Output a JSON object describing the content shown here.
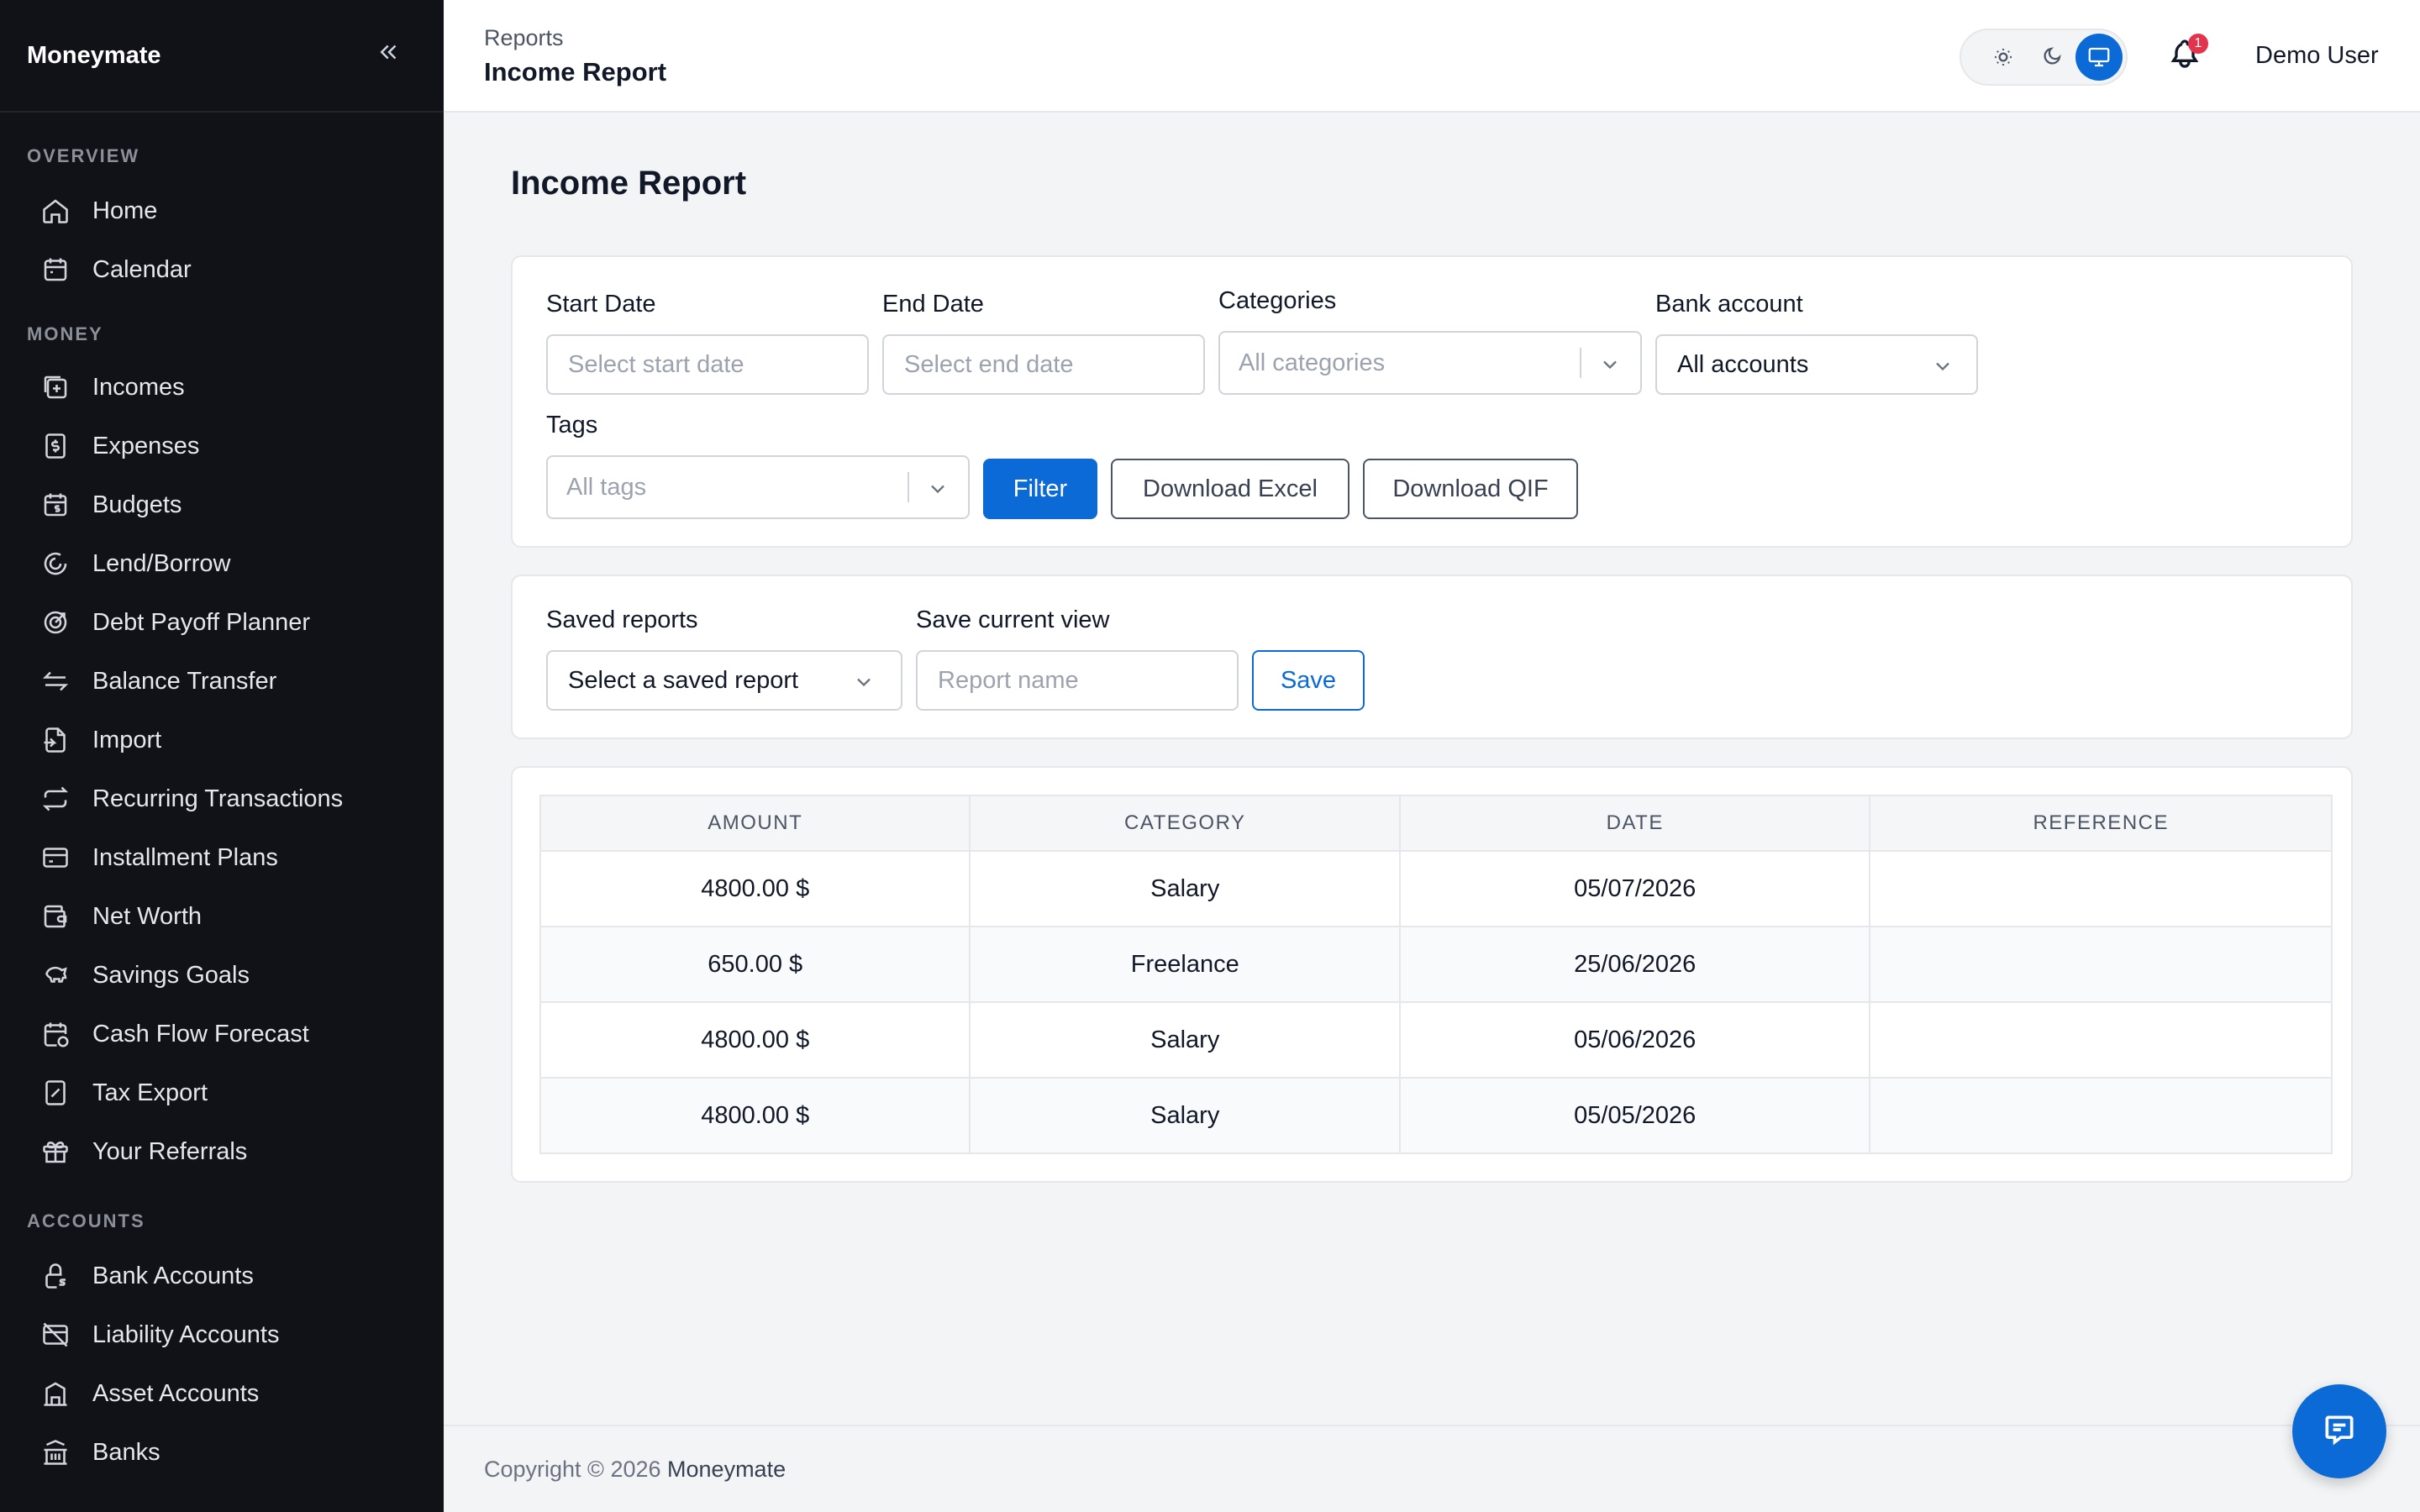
{
  "sidebar": {
    "brand": "Moneymate",
    "collapse_icon": "double-chevron-left-icon",
    "sections": [
      {
        "title": "OVERVIEW",
        "items": [
          {
            "label": "Home",
            "icon": "home-icon"
          },
          {
            "label": "Calendar",
            "icon": "calendar-icon"
          }
        ]
      },
      {
        "title": "MONEY",
        "items": [
          {
            "label": "Incomes",
            "icon": "income-icon"
          },
          {
            "label": "Expenses",
            "icon": "dollar-receipt-icon"
          },
          {
            "label": "Budgets",
            "icon": "budget-calendar-icon"
          },
          {
            "label": "Lend/Borrow",
            "icon": "circular-arrows-icon"
          },
          {
            "label": "Debt Payoff Planner",
            "icon": "target-icon"
          },
          {
            "label": "Balance Transfer",
            "icon": "transfer-arrows-icon"
          },
          {
            "label": "Import",
            "icon": "file-import-icon"
          },
          {
            "label": "Recurring Transactions",
            "icon": "repeat-icon"
          },
          {
            "label": "Installment Plans",
            "icon": "credit-card-icon"
          },
          {
            "label": "Net Worth",
            "icon": "wallet-icon"
          },
          {
            "label": "Savings Goals",
            "icon": "piggy-bank-icon"
          },
          {
            "label": "Cash Flow Forecast",
            "icon": "calendar-dollar-icon"
          },
          {
            "label": "Tax Export",
            "icon": "tax-document-icon"
          },
          {
            "label": "Your Referrals",
            "icon": "gift-icon"
          }
        ]
      },
      {
        "title": "ACCOUNTS",
        "items": [
          {
            "label": "Bank Accounts",
            "icon": "lock-dollar-icon"
          },
          {
            "label": "Liability Accounts",
            "icon": "credit-card-off-icon"
          },
          {
            "label": "Asset Accounts",
            "icon": "building-icon"
          },
          {
            "label": "Banks",
            "icon": "bank-icon"
          }
        ]
      }
    ]
  },
  "header": {
    "breadcrumb_parent": "Reports",
    "breadcrumb_current": "Income Report",
    "theme_icons": [
      "sun-icon",
      "moon-icon",
      "monitor-icon"
    ],
    "theme_active": "monitor-icon",
    "notification_count": "1",
    "user_name": "Demo User"
  },
  "page": {
    "title": "Income Report"
  },
  "filters": {
    "start_date_label": "Start Date",
    "start_date_placeholder": "Select start date",
    "end_date_label": "End Date",
    "end_date_placeholder": "Select end date",
    "categories_label": "Categories",
    "categories_value": "All categories",
    "bank_account_label": "Bank account",
    "bank_account_value": "All accounts",
    "tags_label": "Tags",
    "tags_value": "All tags",
    "filter_button": "Filter",
    "download_excel_button": "Download Excel",
    "download_qif_button": "Download QIF"
  },
  "saved": {
    "saved_reports_label": "Saved reports",
    "saved_reports_value": "Select a saved report",
    "save_view_label": "Save current view",
    "report_name_placeholder": "Report name",
    "save_button": "Save"
  },
  "table": {
    "columns": [
      "AMOUNT",
      "CATEGORY",
      "DATE",
      "REFERENCE"
    ],
    "rows": [
      {
        "amount": "4800.00 $",
        "category": "Salary",
        "date": "05/07/2026",
        "reference": ""
      },
      {
        "amount": "650.00 $",
        "category": "Freelance",
        "date": "25/06/2026",
        "reference": ""
      },
      {
        "amount": "4800.00 $",
        "category": "Salary",
        "date": "05/06/2026",
        "reference": ""
      },
      {
        "amount": "4800.00 $",
        "category": "Salary",
        "date": "05/05/2026",
        "reference": ""
      }
    ]
  },
  "footer": {
    "copyright": "Copyright © 2026",
    "brand": "Moneymate"
  },
  "chat_button_icon": "chat-icon",
  "colors": {
    "sidebar_bg": "#111118",
    "primary": "#0c6ad6",
    "badge": "#e3344d",
    "page_bg": "#f3f4f6"
  }
}
